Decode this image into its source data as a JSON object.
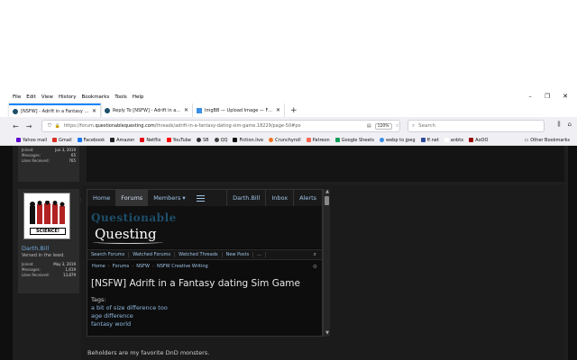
{
  "menubar": {
    "items": [
      "File",
      "Edit",
      "View",
      "History",
      "Bookmarks",
      "Tools",
      "Help"
    ]
  },
  "tabs": [
    {
      "title": "[NSFW] - Adrift in a Fantasy dati",
      "active": true
    },
    {
      "title": "Reply To [NSFW] - Adrift in a Fa",
      "active": false
    },
    {
      "title": "ImgBB — Upload Image — Free",
      "active": false
    }
  ],
  "navbar": {
    "url_prefix": "https://forum.",
    "url_domain": "questionablequesting.com",
    "url_rest": "/threads/adrift-in-a-fantasy-dating-sim-game.18229/page-50#po",
    "zoom": "120%",
    "search_placeholder": "Search"
  },
  "bookmarks": [
    {
      "label": "Yahoo mail",
      "color": "#6001d2"
    },
    {
      "label": "Gmail",
      "color": "#d93025"
    },
    {
      "label": "Facebook",
      "color": "#1877f2"
    },
    {
      "label": "Amazon",
      "color": "#222222"
    },
    {
      "label": "Netflix",
      "color": "#e50914"
    },
    {
      "label": "YouTube",
      "color": "#ff0000"
    },
    {
      "label": "SB",
      "color": "#333333"
    },
    {
      "label": "QQ",
      "color": "#444444"
    },
    {
      "label": "Fiction.live",
      "color": "#111111"
    },
    {
      "label": "Crunchyroll",
      "color": "#f47521"
    },
    {
      "label": "Patreon",
      "color": "#f96854"
    },
    {
      "label": "Google Sheets",
      "color": "#0f9d58"
    },
    {
      "label": "webp to jpeg",
      "color": "#3a8ee6"
    },
    {
      "label": "ff.net",
      "color": "#2d4b9a"
    },
    {
      "label": "anbtx",
      "color": "#ffffff"
    },
    {
      "label": "AoOO",
      "color": "#990000"
    }
  ],
  "other_bookmarks": "Other Bookmarks",
  "prev_user": {
    "stats": [
      {
        "label": "Joined:",
        "value": "Jun 3, 2019"
      },
      {
        "label": "Messages:",
        "value": "65"
      },
      {
        "label": "Likes Received:",
        "value": "765"
      }
    ]
  },
  "user": {
    "name": "Darth.Bill",
    "title": "Versed in the lewd.",
    "avatar_text": "SCIENCE!",
    "stats": [
      {
        "label": "Joined:",
        "value": "May 3, 2019"
      },
      {
        "label": "Messages:",
        "value": "1,619"
      },
      {
        "label": "Likes Received:",
        "value": "13,879"
      }
    ]
  },
  "forum_nav": {
    "home": "Home",
    "forums": "Forums",
    "members": "Members",
    "account": "Darth.Bill",
    "inbox": "Inbox",
    "alerts": "Alerts"
  },
  "logo": {
    "line1": "Questionable",
    "line2": "Questing"
  },
  "subnav": [
    "Search Forums",
    "Watched Forums",
    "Watched Threads",
    "New Posts",
    "..."
  ],
  "breadcrumb": [
    "Home",
    "Forums",
    "NSFW",
    "NSFW Creative Writing"
  ],
  "thread": {
    "title": "[NSFW] Adrift in a Fantasy dating Sim Game",
    "tags_label": "Tags:",
    "tags": [
      "a bit of size difference too",
      "age difference",
      "fantasy world"
    ]
  },
  "post_body": "Beholders are my favorite DnD monsters."
}
